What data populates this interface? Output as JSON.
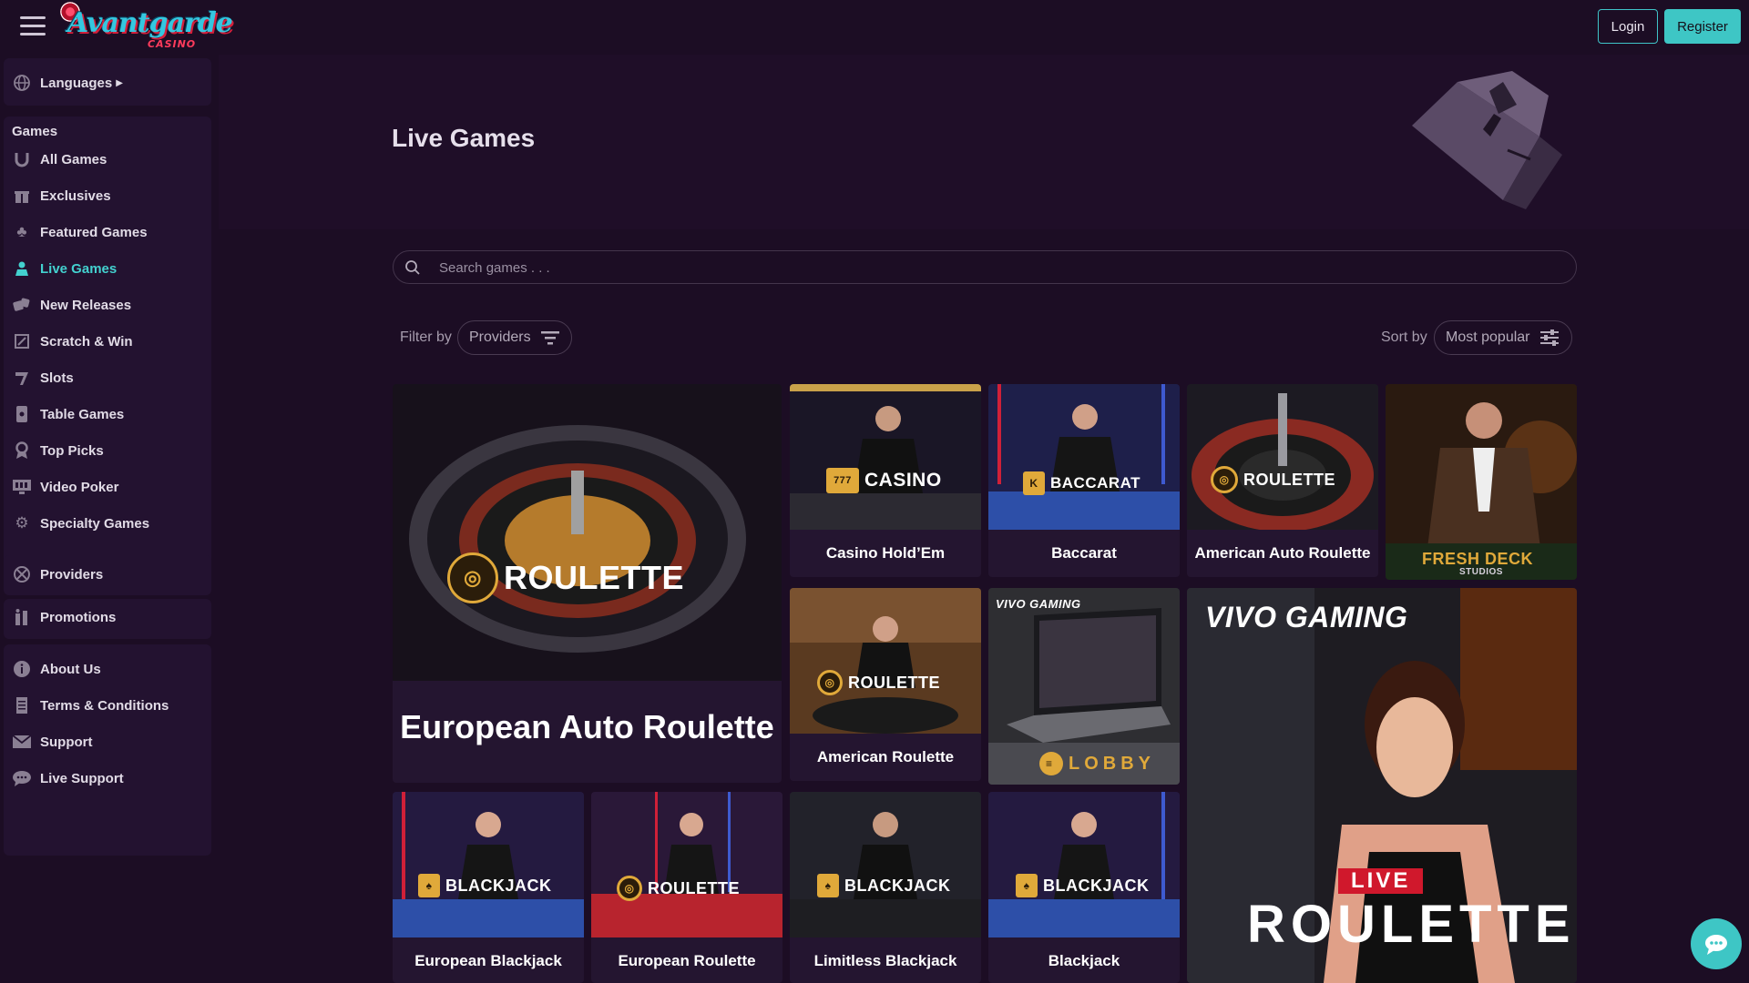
{
  "header": {
    "logo_text": "Avantgarde",
    "logo_sub": "CASINO",
    "login_label": "Login",
    "register_label": "Register"
  },
  "sidebar": {
    "languages_label": "Languages",
    "games_heading": "Games",
    "game_items": [
      {
        "label": "All Games",
        "icon": "horseshoe-icon"
      },
      {
        "label": "Exclusives",
        "icon": "gift-icon"
      },
      {
        "label": "Featured Games",
        "icon": "clover-icon"
      },
      {
        "label": "Live Games",
        "icon": "dealer-icon",
        "active": true
      },
      {
        "label": "New Releases",
        "icon": "dice-icon"
      },
      {
        "label": "Scratch & Win",
        "icon": "scratch-card-icon"
      },
      {
        "label": "Slots",
        "icon": "slot-lever-icon"
      },
      {
        "label": "Table Games",
        "icon": "card-icon"
      },
      {
        "label": "Top Picks",
        "icon": "ribbon-icon"
      },
      {
        "label": "Video Poker",
        "icon": "monitor-icon"
      },
      {
        "label": "Specialty Games",
        "icon": "gear-icon"
      }
    ],
    "providers_label": "Providers",
    "promotions_label": "Promotions",
    "info_items": [
      {
        "label": "About Us",
        "icon": "info-icon"
      },
      {
        "label": "Terms & Conditions",
        "icon": "document-icon"
      },
      {
        "label": "Support",
        "icon": "mail-icon"
      },
      {
        "label": "Live Support",
        "icon": "chat-icon"
      }
    ]
  },
  "main": {
    "title": "Live Games",
    "search_placeholder": "Search games . . .",
    "filter_label": "Filter by",
    "filter_value": "Providers",
    "sort_label": "Sort by",
    "sort_value": "Most popular",
    "games": [
      {
        "name": "European Auto Roulette",
        "badge": "ROULETTE"
      },
      {
        "name": "Casino Hold’Em",
        "badge": "CASINO"
      },
      {
        "name": "Baccarat",
        "badge": "BACCARAT"
      },
      {
        "name": "American Auto Roulette",
        "badge": "ROULETTE"
      },
      {
        "name": "",
        "badge": "FRESH DECK",
        "badge_sub": "STUDIOS"
      },
      {
        "name": "American Roulette",
        "badge": "ROULETTE"
      },
      {
        "name": "",
        "badge": "LOBBY",
        "brand": "VIVO GAMING"
      },
      {
        "name": "",
        "badge_top": "LIVE",
        "badge": "ROULETTE",
        "brand": "VIVO GAMING"
      },
      {
        "name": "European Blackjack",
        "badge": "BLACKJACK"
      },
      {
        "name": "European Roulette",
        "badge": "ROULETTE"
      },
      {
        "name": "Limitless Blackjack",
        "badge": "BLACKJACK"
      },
      {
        "name": "Blackjack",
        "badge": "BLACKJACK"
      }
    ]
  },
  "colors": {
    "background": "#1c0d24",
    "accent": "#3ec6c5",
    "gold": "#e0a93a"
  }
}
